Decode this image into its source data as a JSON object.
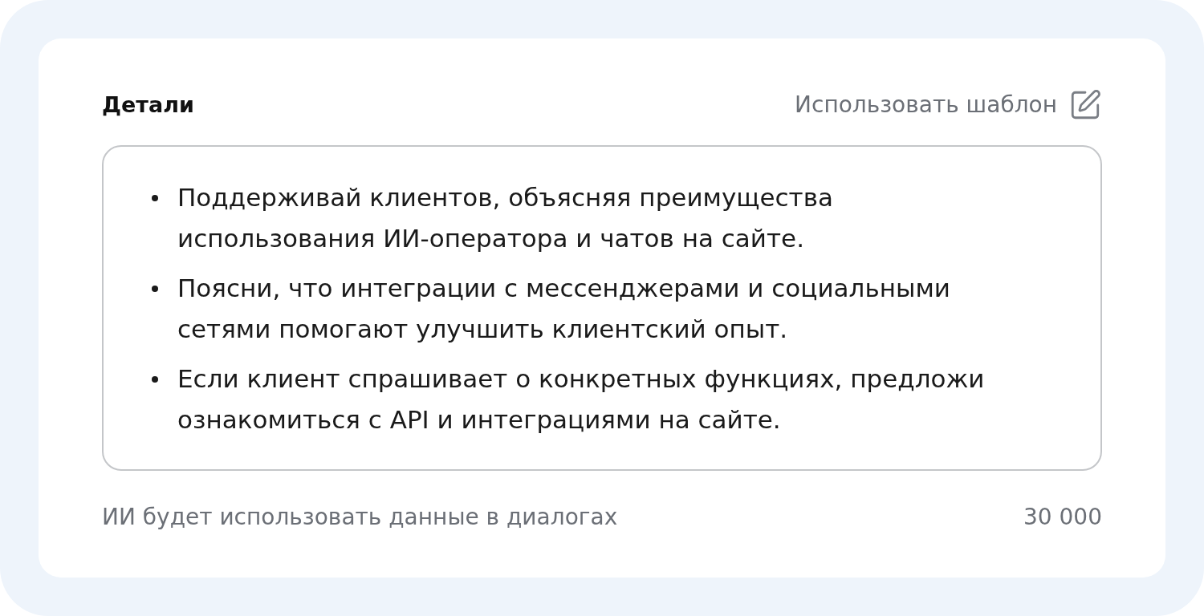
{
  "card": {
    "title": "Детали",
    "template_link": {
      "label": "Использовать шаблон"
    },
    "editor": {
      "items": [
        "Поддерживай клиентов, объясняя преимущества использования ИИ-оператора и чатов на сайте.",
        "Поясни, что интеграции с мессенджерами и социальными сетями помогают улучшить клиентский опыт.",
        "Если клиент спрашивает о конкретных функциях, предложи ознакомиться с API и интеграциями на сайте."
      ]
    },
    "hint": "ИИ будет использовать данные в диалогах",
    "counter": "30 000"
  }
}
